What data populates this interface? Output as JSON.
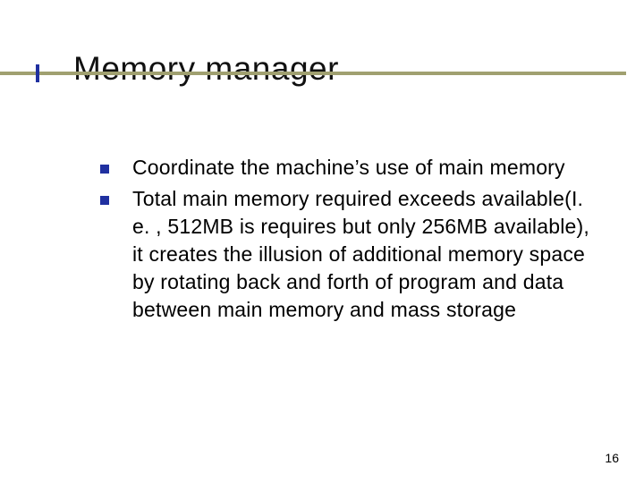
{
  "title": "Memory manager",
  "bullets": [
    "Coordinate the machine’s use of main memory",
    "Total main memory required exceeds available(I. e. , 512MB is requires but only 256MB available), it creates the illusion of additional memory space by rotating back and forth of program and data between main memory and mass storage"
  ],
  "page_number": "16"
}
